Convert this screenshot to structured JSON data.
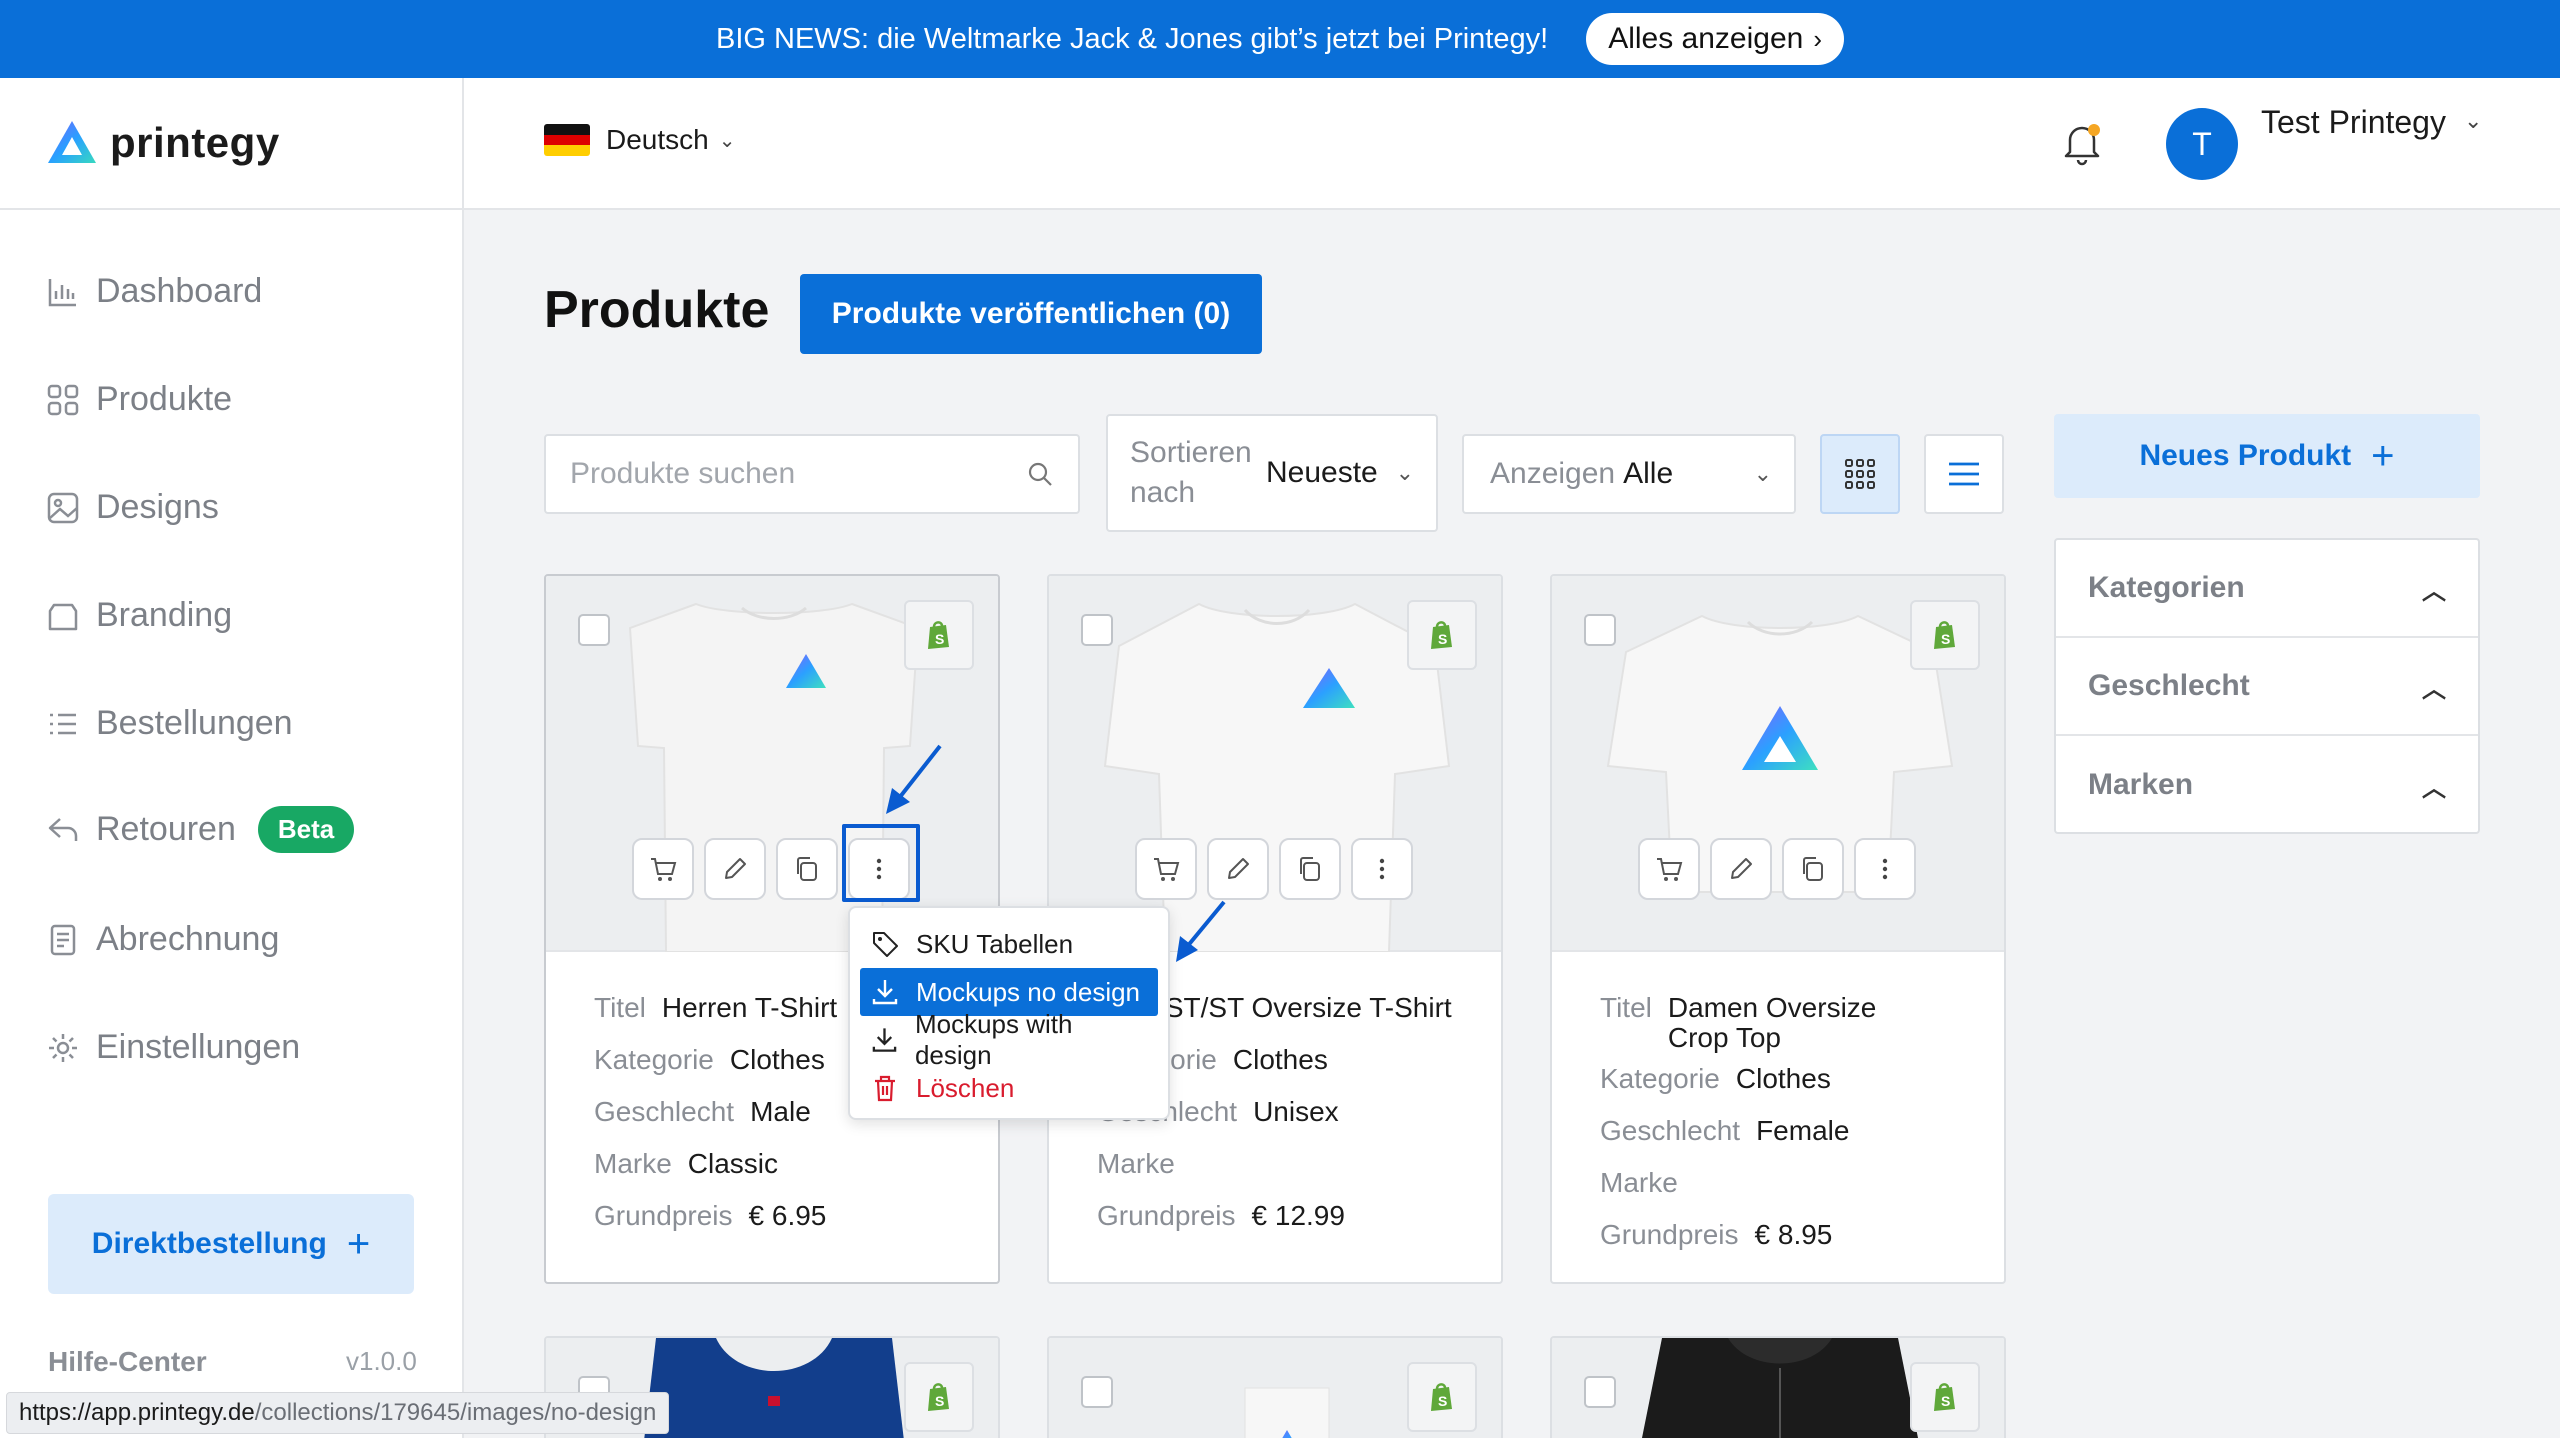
{
  "banner": {
    "text": "BIG NEWS: die Weltmarke Jack & Jones gibt’s jetzt bei Printegy!",
    "button_label": "Alles anzeigen",
    "button_chevron": "›"
  },
  "brand": {
    "name": "printegy"
  },
  "header": {
    "language": "Deutsch",
    "user_initial": "T",
    "user_name": "Test Printegy"
  },
  "sidebar": {
    "items": [
      {
        "label": "Dashboard",
        "icon": "chart-icon"
      },
      {
        "label": "Produkte",
        "icon": "grid-icon"
      },
      {
        "label": "Designs",
        "icon": "image-icon"
      },
      {
        "label": "Branding",
        "icon": "bag-icon"
      },
      {
        "label": "Bestellungen",
        "icon": "list-icon"
      },
      {
        "label": "Retouren",
        "icon": "return-icon",
        "badge": "Beta"
      },
      {
        "label": "Abrechnung",
        "icon": "invoice-icon"
      },
      {
        "label": "Einstellungen",
        "icon": "gear-icon"
      }
    ],
    "direct_order_label": "Direktbestellung",
    "help_label": "Hilfe-Center",
    "version": "v1.0.0"
  },
  "main": {
    "title": "Produkte",
    "publish_label": "Produkte veröffentlichen (0)",
    "search_placeholder": "Produkte suchen",
    "sort_label": "Sortieren nach",
    "sort_value": "Neueste",
    "show_label": "Anzeigen",
    "show_value": "Alle",
    "new_product_label": "Neues Produkt"
  },
  "filters": [
    "Kategorien",
    "Geschlecht",
    "Marken"
  ],
  "field_labels": {
    "title": "Titel",
    "category": "Kategorie",
    "gender": "Geschlecht",
    "brand": "Marke",
    "base_price": "Grundpreis"
  },
  "products": [
    {
      "title": "Herren T-Shirt",
      "category": "Clothes",
      "gender": "Male",
      "brand": "Classic",
      "price": "€ 6.95"
    },
    {
      "title": "ST/ST Oversize T-Shirt",
      "category": "Clothes",
      "gender": "Unisex",
      "brand": "",
      "price": "€ 12.99"
    },
    {
      "title": "Damen Oversize Crop Top",
      "category": "Clothes",
      "gender": "Female",
      "brand": "",
      "price": "€ 8.95"
    }
  ],
  "context_menu": {
    "items": [
      {
        "label": "SKU Tabellen",
        "icon": "tag-icon"
      },
      {
        "label": "Mockups no design",
        "icon": "download-icon"
      },
      {
        "label": "Mockups with design",
        "icon": "download-icon"
      },
      {
        "label": "Löschen",
        "icon": "trash-icon"
      }
    ]
  },
  "status_url": {
    "host": "https://app.printegy.de",
    "path": "/collections/179645/images/no-design"
  },
  "colors": {
    "primary": "#0a6fd8",
    "success": "#18a864",
    "danger": "#d91c2e"
  }
}
